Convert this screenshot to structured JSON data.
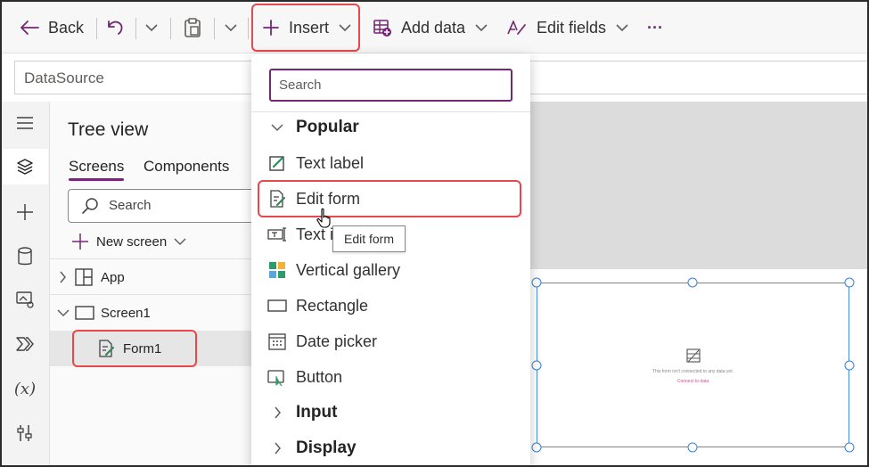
{
  "toolbar": {
    "back_label": "Back",
    "insert_label": "Insert",
    "add_data_label": "Add data",
    "edit_fields_label": "Edit fields",
    "more_label": "···"
  },
  "formula_bar": {
    "property": "DataSource"
  },
  "tree_view": {
    "title": "Tree view",
    "tabs": [
      {
        "label": "Screens",
        "active": true
      },
      {
        "label": "Components",
        "active": false
      }
    ],
    "search_placeholder": "Search",
    "new_screen_label": "New screen",
    "nodes": [
      {
        "label": "App"
      },
      {
        "label": "Screen1"
      },
      {
        "label": "Form1",
        "selected": true
      }
    ]
  },
  "insert_menu": {
    "search_placeholder": "Search",
    "items": [
      {
        "label": "Popular",
        "kind": "group",
        "icon": "chevron-down-icon"
      },
      {
        "label": "Text label",
        "kind": "item",
        "icon": "text-label-icon"
      },
      {
        "label": "Edit form",
        "kind": "item",
        "icon": "edit-form-icon"
      },
      {
        "label": "Text i",
        "kind": "item",
        "icon": "text-input-icon"
      },
      {
        "label": "Vertical gallery",
        "kind": "item",
        "icon": "gallery-icon"
      },
      {
        "label": "Rectangle",
        "kind": "item",
        "icon": "rectangle-icon"
      },
      {
        "label": "Date picker",
        "kind": "item",
        "icon": "calendar-icon"
      },
      {
        "label": "Button",
        "kind": "item",
        "icon": "button-icon"
      },
      {
        "label": "Input",
        "kind": "group",
        "icon": "chevron-right-icon"
      },
      {
        "label": "Display",
        "kind": "group",
        "icon": "chevron-right-icon"
      }
    ],
    "tooltip": "Edit form"
  },
  "canvas": {
    "form_message": "This form isn't connected to any data yet.",
    "form_link": "Connect to data"
  },
  "colors": {
    "accent": "#742774",
    "highlight": "#e8474b",
    "selection": "#4a90d9"
  }
}
